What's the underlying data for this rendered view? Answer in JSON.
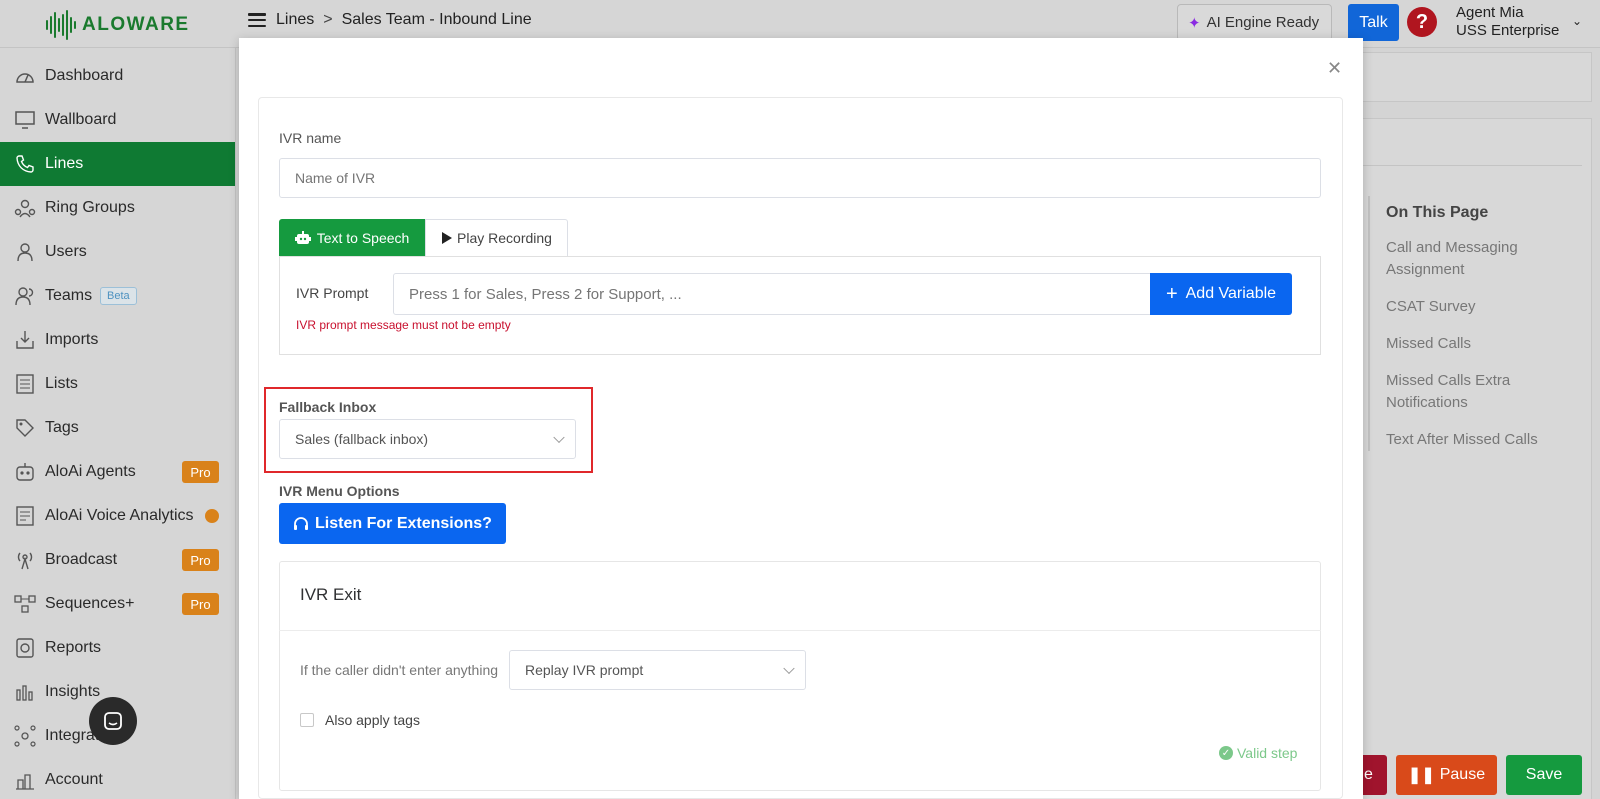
{
  "header": {
    "logo_text": "ALOWARE",
    "breadcrumb": [
      "Lines",
      "Sales Team - Inbound Line"
    ],
    "breadcrumb_sep": ">",
    "ai_status": "AI Engine Ready",
    "talk_label": "Talk",
    "agent_name": "Agent Mia",
    "agent_company": "USS Enterprise"
  },
  "sidebar": {
    "items": [
      {
        "label": "Dashboard",
        "icon": "dashboard-icon"
      },
      {
        "label": "Wallboard",
        "icon": "monitor-icon"
      },
      {
        "label": "Lines",
        "icon": "phone-icon",
        "active": true
      },
      {
        "label": "Ring Groups",
        "icon": "ring-groups-icon"
      },
      {
        "label": "Users",
        "icon": "users-icon"
      },
      {
        "label": "Teams",
        "icon": "teams-icon",
        "badge": "Beta"
      },
      {
        "label": "Imports",
        "icon": "import-icon"
      },
      {
        "label": "Lists",
        "icon": "list-icon"
      },
      {
        "label": "Tags",
        "icon": "tag-icon"
      },
      {
        "label": "AloAi Agents",
        "icon": "robot-icon",
        "badge": "Pro"
      },
      {
        "label": "AloAi Voice Analytics",
        "icon": "analytics-icon"
      },
      {
        "label": "Broadcast",
        "icon": "broadcast-icon",
        "badge": "Pro"
      },
      {
        "label": "Sequences+",
        "icon": "sequences-icon",
        "badge": "Pro"
      },
      {
        "label": "Reports",
        "icon": "reports-icon"
      },
      {
        "label": "Insights",
        "icon": "insights-icon"
      },
      {
        "label": "Integrations",
        "icon": "integrations-icon"
      },
      {
        "label": "Account",
        "icon": "account-icon"
      }
    ]
  },
  "on_this_page": {
    "title": "On This Page",
    "links": [
      "Call and Messaging Assignment",
      "CSAT Survey",
      "Missed Calls",
      "Missed Calls Extra Notifications",
      "Text After Missed Calls"
    ]
  },
  "footer_buttons": {
    "partial_label": "e",
    "pause_label": "Pause",
    "save_label": "Save"
  },
  "modal": {
    "ivr_name_label": "IVR name",
    "ivr_name_placeholder": "Name of IVR",
    "tab_tts": "Text to Speech",
    "tab_play": "Play Recording",
    "ivr_prompt_label": "IVR Prompt",
    "ivr_prompt_placeholder": "Press 1 for Sales, Press 2 for Support, ...",
    "add_variable_label": "Add Variable",
    "prompt_error": "IVR prompt message must not be empty",
    "fallback_label": "Fallback Inbox",
    "fallback_value": "Sales (fallback inbox)",
    "menu_options_label": "IVR Menu Options",
    "listen_label": "Listen For Extensions?",
    "exit_title": "IVR Exit",
    "no_input_label": "If the caller didn't enter anything",
    "no_input_value": "Replay IVR prompt",
    "apply_tags_label": "Also apply tags",
    "valid_label": "Valid step"
  },
  "colors": {
    "brand_green": "#0f7a33",
    "primary_blue": "#0a66f0",
    "pro_orange": "#d9821a",
    "error_red": "#c8102e",
    "highlight_red": "#e0282b"
  }
}
